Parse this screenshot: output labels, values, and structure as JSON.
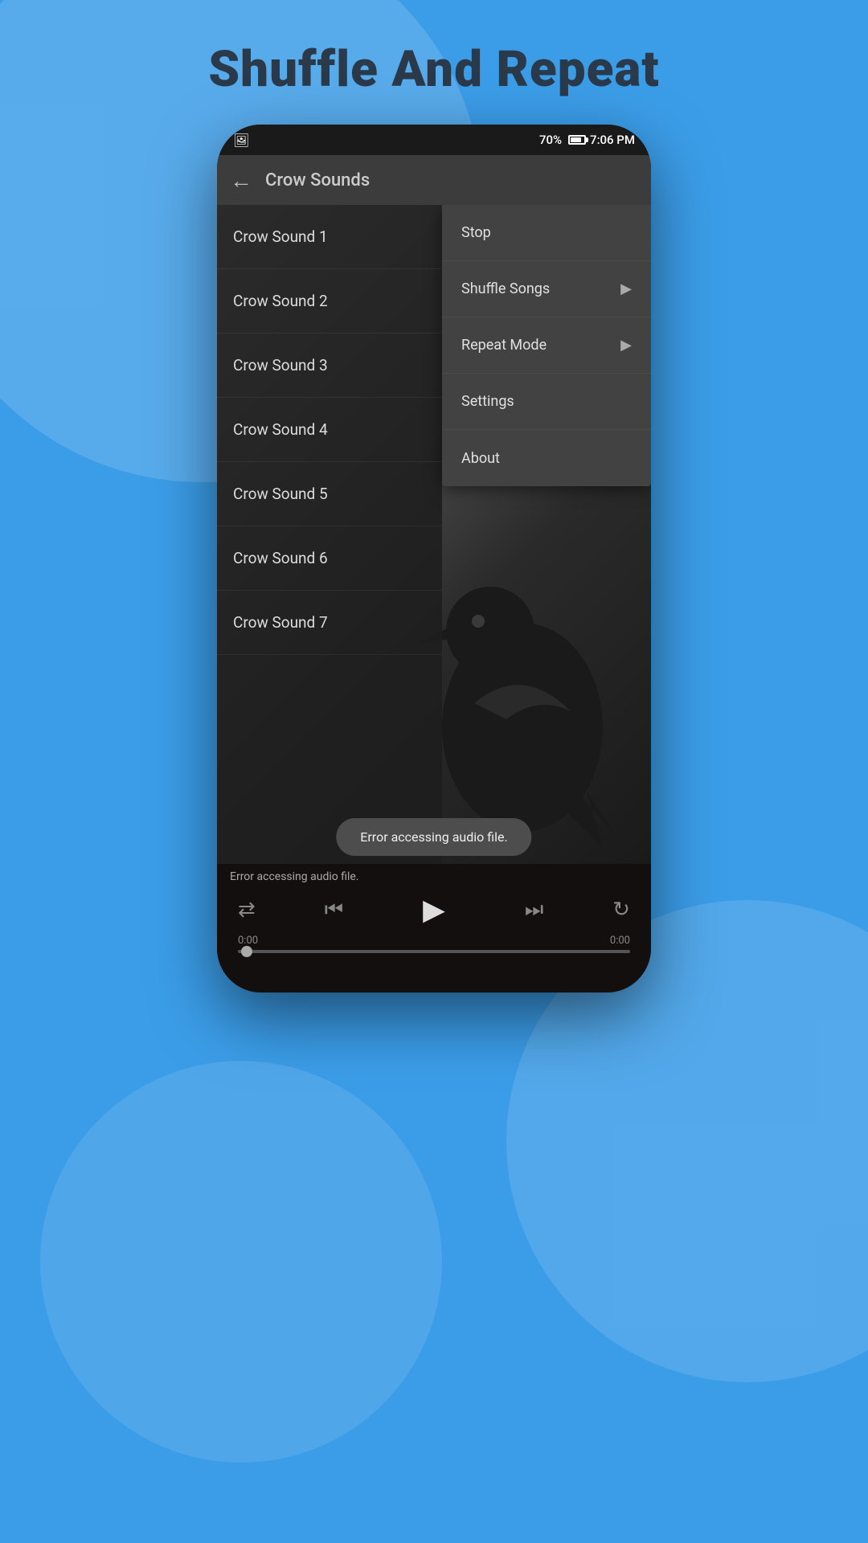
{
  "page": {
    "title": "Shuffle And Repeat",
    "bg_color": "#3b9de8"
  },
  "status_bar": {
    "time": "7:06 PM",
    "battery_percent": "70%"
  },
  "app_bar": {
    "title": "Crow Sounds",
    "back_label": "←"
  },
  "songs": [
    {
      "label": "Crow Sound 1"
    },
    {
      "label": "Crow Sound 2"
    },
    {
      "label": "Crow Sound 3"
    },
    {
      "label": "Crow Sound 4"
    },
    {
      "label": "Crow Sound 5"
    },
    {
      "label": "Crow Sound 6"
    },
    {
      "label": "Crow Sound 7"
    }
  ],
  "context_menu": {
    "items": [
      {
        "label": "Stop",
        "has_arrow": false
      },
      {
        "label": "Shuffle Songs",
        "has_arrow": true
      },
      {
        "label": "Repeat Mode",
        "has_arrow": true
      },
      {
        "label": "Settings",
        "has_arrow": false
      },
      {
        "label": "About",
        "has_arrow": false
      }
    ]
  },
  "player": {
    "error_text": "Error accessing audio file.",
    "time_start": "0:00",
    "time_end": "0:00",
    "error_toast": "Error accessing audio file."
  }
}
